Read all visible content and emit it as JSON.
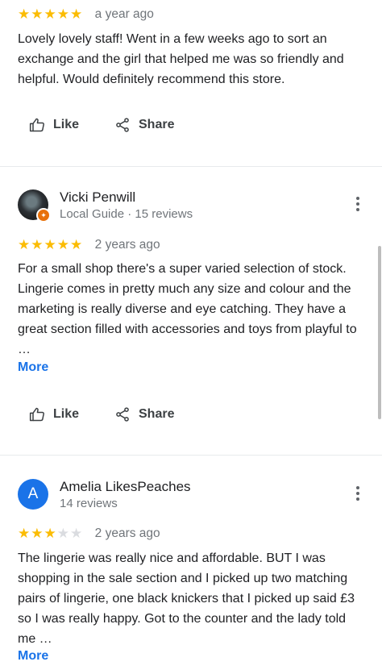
{
  "reviews": [
    {
      "stars": 5,
      "date": "a year ago",
      "text": "Lovely lovely staff! Went in a few weeks ago to sort an exchange and the girl that helped me was so friendly and helpful. Would definitely recommend this store.",
      "like_label": "Like",
      "share_label": "Share"
    },
    {
      "author": "Vicki Penwill",
      "meta": "Local Guide · 15 reviews",
      "stars": 5,
      "date": "2 years ago",
      "text": "For a small shop there's a super varied selection of stock. Lingerie comes in pretty much any size and colour and the marketing is really diverse and eye catching. They have a great section filled with accessories and toys from playful to …",
      "more_label": "More",
      "like_label": "Like",
      "share_label": "Share"
    },
    {
      "author": "Amelia LikesPeaches",
      "avatar_letter": "A",
      "meta": "14 reviews",
      "stars": 3,
      "date": "2 years ago",
      "text": "The lingerie was really nice and affordable. BUT I was shopping in the sale section and I picked up two matching pairs of lingerie, one black knickers that I picked up said £3 so I was really happy. Got to the counter and the lady told me …",
      "more_label": "More"
    }
  ],
  "colors": {
    "star_filled": "#fbbc04",
    "star_empty": "#dadce0",
    "link": "#1a73e8",
    "avatar_bg": "#1a73e8",
    "local_guide_badge": "#e8710a"
  },
  "icons": {
    "like": "thumb-up-icon",
    "share": "share-icon",
    "menu": "more-vert-icon",
    "star": "star-icon"
  }
}
